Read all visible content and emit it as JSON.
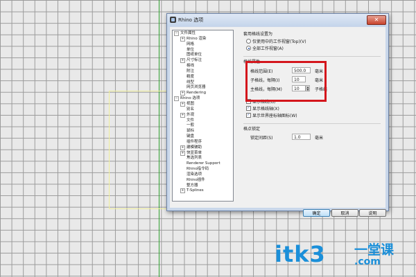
{
  "dialog": {
    "title": "Rhino 选项",
    "close_glyph": "✕"
  },
  "tree": [
    {
      "label": "文件属性",
      "level": 0,
      "exp": "−"
    },
    {
      "label": "Rhino 渲染",
      "level": 1,
      "exp": "+"
    },
    {
      "label": "网格",
      "level": 1,
      "exp": ""
    },
    {
      "label": "单位",
      "level": 1,
      "exp": ""
    },
    {
      "label": "图纸单位",
      "level": 1,
      "exp": ""
    },
    {
      "label": "尺寸标注",
      "level": 1,
      "exp": "+"
    },
    {
      "label": "格线",
      "level": 1,
      "exp": ""
    },
    {
      "label": "附注",
      "level": 1,
      "exp": ""
    },
    {
      "label": "精度",
      "level": 1,
      "exp": ""
    },
    {
      "label": "线型",
      "level": 1,
      "exp": ""
    },
    {
      "label": "网页浏览器",
      "level": 1,
      "exp": ""
    },
    {
      "label": "Rendering",
      "level": 1,
      "exp": "+"
    },
    {
      "label": "Rhino 选项",
      "level": 0,
      "exp": "−"
    },
    {
      "label": "视图",
      "level": 1,
      "exp": "+"
    },
    {
      "label": "别名",
      "level": 1,
      "exp": ""
    },
    {
      "label": "外观",
      "level": 1,
      "exp": "+"
    },
    {
      "label": "文件",
      "level": 1,
      "exp": ""
    },
    {
      "label": "一般",
      "level": 1,
      "exp": ""
    },
    {
      "label": "鼠标",
      "level": 1,
      "exp": ""
    },
    {
      "label": "键盘",
      "level": 1,
      "exp": ""
    },
    {
      "label": "插件程序",
      "level": 1,
      "exp": ""
    },
    {
      "label": "建模辅助",
      "level": 1,
      "exp": "+"
    },
    {
      "label": "快显菜单",
      "level": 1,
      "exp": "+"
    },
    {
      "label": "焦选列表",
      "level": 1,
      "exp": ""
    },
    {
      "label": "Renderer Support",
      "level": 1,
      "exp": ""
    },
    {
      "label": "Rhino指令码",
      "level": 1,
      "exp": ""
    },
    {
      "label": "渲染选项",
      "level": 1,
      "exp": ""
    },
    {
      "label": "Rhino插件",
      "level": 1,
      "exp": ""
    },
    {
      "label": "整方器",
      "level": 1,
      "exp": ""
    },
    {
      "label": "T-Splines",
      "level": 1,
      "exp": "+"
    }
  ],
  "apply_section": {
    "title": "套用格线设置为",
    "options": [
      {
        "label": "仅使用中的工作视窗(Top)(V)",
        "selected": false
      },
      {
        "label": "全部工作视窗(A)",
        "selected": true
      }
    ]
  },
  "grid_section": {
    "title": "格线属性",
    "extents_label": "格线范围(E)",
    "extents_value": "500.0",
    "extents_unit": "毫米",
    "minor_label": "子格线，每隔(I)",
    "minor_value": "10",
    "minor_unit": "毫米",
    "major_label": "主格线，每隔(M)",
    "major_value": "10",
    "major_unit": "子格线",
    "checks": [
      {
        "label": "显示格线(G)",
        "checked": true
      },
      {
        "label": "显示格线轴(X)",
        "checked": true
      },
      {
        "label": "显示世界座标轴图标(W)",
        "checked": true
      }
    ]
  },
  "snap_section": {
    "title": "格点锁定",
    "spacing_label": "锁定间距(S)",
    "spacing_value": "1.0",
    "spacing_unit": "毫米"
  },
  "buttons": {
    "ok": "确定",
    "cancel": "取消",
    "help": "说明"
  },
  "watermark": {
    "main": "itk3",
    "side": "一堂课",
    "sub": ".com"
  },
  "colors": {
    "highlight": "#d4161c",
    "watermark": "#1a8fd9",
    "axis_green": "#2fa02f"
  }
}
